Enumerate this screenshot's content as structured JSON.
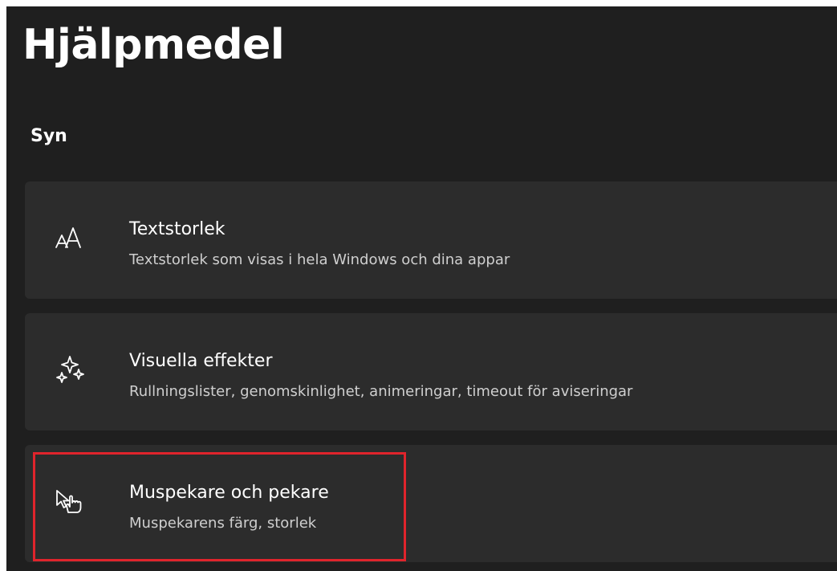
{
  "page": {
    "title": "Hjälpmedel"
  },
  "section": {
    "title": "Syn"
  },
  "items": [
    {
      "icon": "text-size-icon",
      "title": "Textstorlek",
      "subtitle": "Textstorlek som visas i hela Windows och dina appar"
    },
    {
      "icon": "sparkle-icon",
      "title": "Visuella effekter",
      "subtitle": "Rullningslister, genomskinlighet, animeringar, timeout för aviseringar"
    },
    {
      "icon": "mouse-pointer-hand-icon",
      "title": "Muspekare och pekare",
      "subtitle": "Muspekarens färg, storlek"
    }
  ],
  "colors": {
    "background": "#1f1f1f",
    "card": "#2c2c2c",
    "highlight": "#e0242c",
    "text": "#ffffff",
    "subtext": "#cfcfcf"
  }
}
